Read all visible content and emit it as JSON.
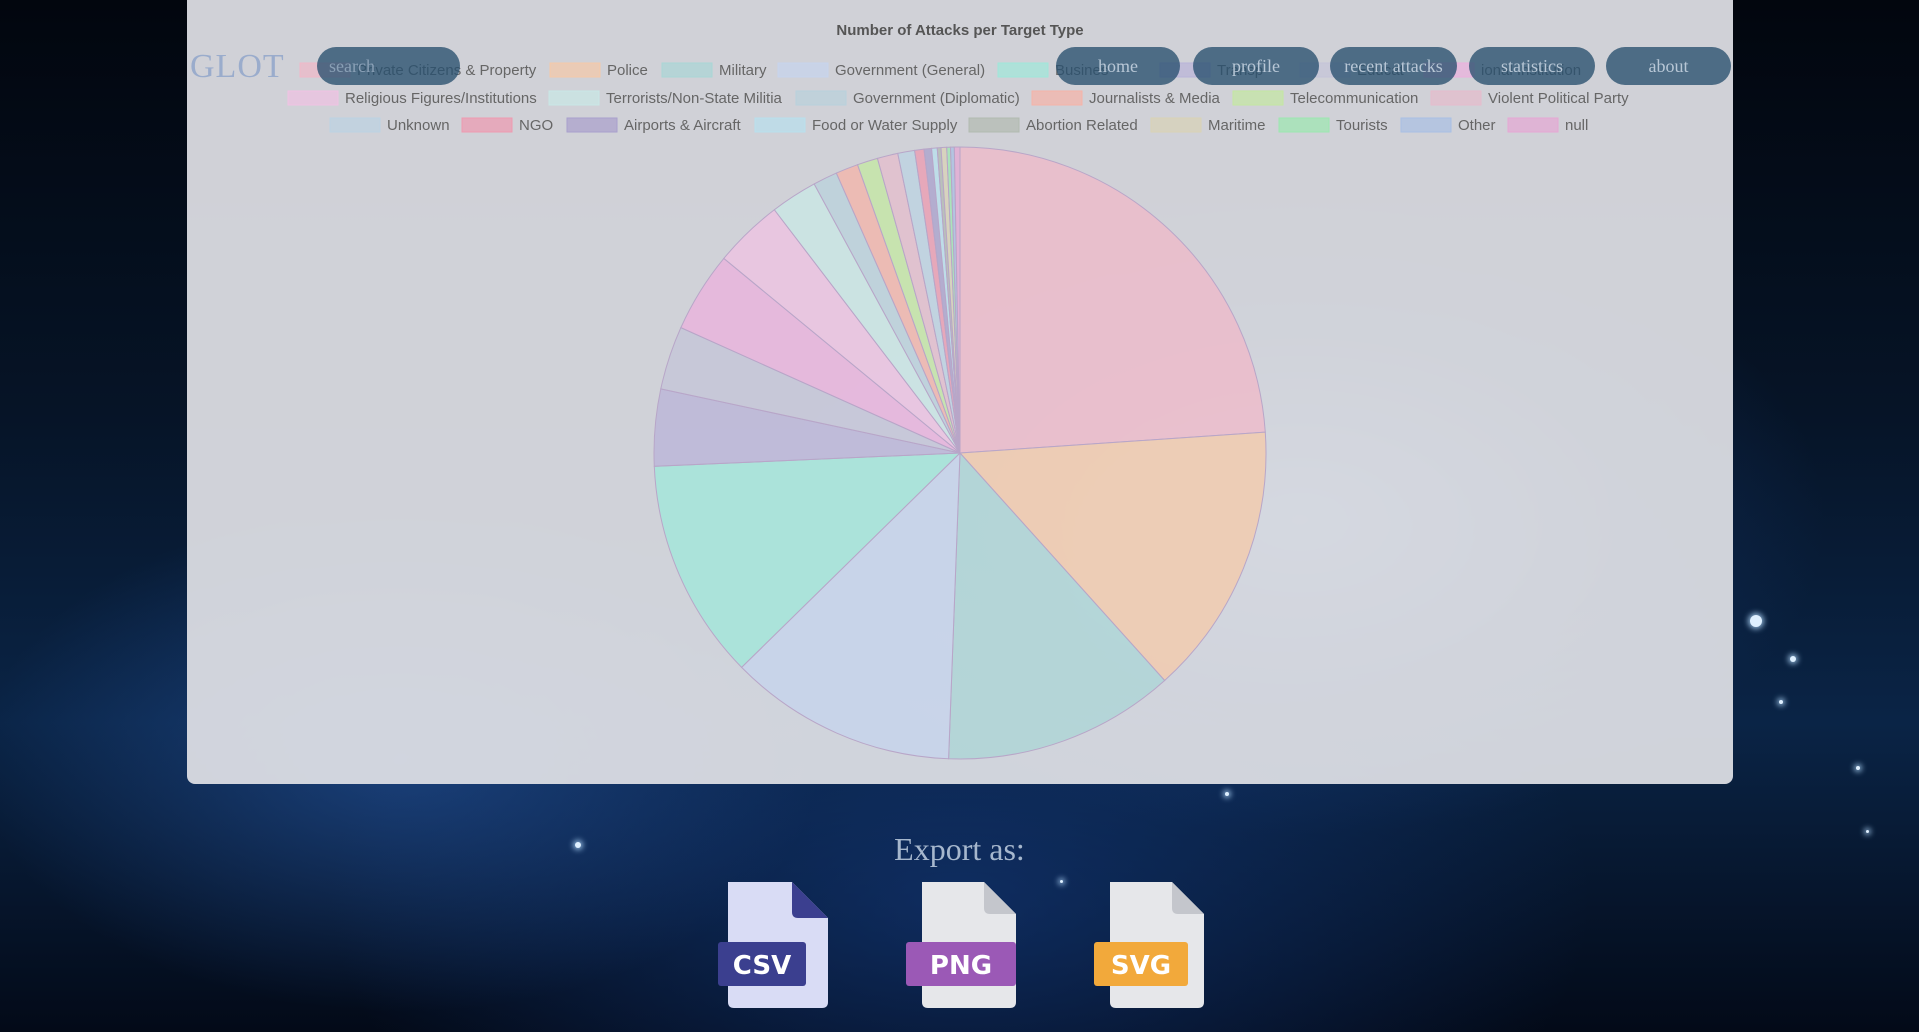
{
  "nav": {
    "logo": "GLOT",
    "search_placeholder": "search",
    "items": [
      "home",
      "profile",
      "recent attacks",
      "statistics",
      "about"
    ]
  },
  "export": {
    "title": "Export as:",
    "formats": [
      {
        "label": "CSV",
        "color": "#3b3f8f",
        "page": "#d9dcf5",
        "fold": "#3b3f8f"
      },
      {
        "label": "PNG",
        "color": "#9b59b6",
        "page": "#e6e7ea",
        "fold": "#c4c6cc"
      },
      {
        "label": "SVG",
        "color": "#f2a93b",
        "page": "#e6e7ea",
        "fold": "#c4c6cc"
      }
    ]
  },
  "chart_data": {
    "type": "pie",
    "title": "Number of Attacks per Target Type",
    "legend_position": "top",
    "categories": [
      "Private Citizens & Property",
      "Police",
      "Military",
      "Government (General)",
      "Business",
      "Transportation",
      "Utilities",
      "Educational Institution",
      "Religious Figures/Institutions",
      "Terrorists/Non-State Militia",
      "Government (Diplomatic)",
      "Journalists & Media",
      "Telecommunication",
      "Violent Political Party",
      "Unknown",
      "NGO",
      "Airports & Aircraft",
      "Food or Water Supply",
      "Abortion Related",
      "Maritime",
      "Tourists",
      "Other",
      "null"
    ],
    "legend_labels_visible": [
      "Private Citizens & Property",
      "Police",
      "Military",
      "Government (General)",
      "Busines",
      "Transp",
      "Educat",
      "ional Institution",
      "Religious Figures/Institutions",
      "Terrorists/Non-State Militia",
      "Government (Diplomatic)",
      "Journalists & Media",
      "Telecommunication",
      "Violent Political Party",
      "Unknown",
      "NGO",
      "Airports & Aircraft",
      "Food or Water Supply",
      "Abortion Related",
      "Maritime",
      "Tourists",
      "Other",
      "null"
    ],
    "values": [
      24.2,
      14.6,
      12.4,
      12.2,
      11.8,
      4.1,
      3.4,
      4.3,
      3.7,
      2.5,
      1.3,
      1.2,
      1.1,
      1.1,
      0.9,
      0.5,
      0.4,
      0.3,
      0.2,
      0.3,
      0.2,
      0.2,
      0.3
    ],
    "colors": [
      "#f0b8c8",
      "#f5c9a8",
      "#a9d6d6",
      "#c6d4ee",
      "#9fe8da",
      "#b9b3d8",
      "#c4c4d8",
      "#ecb0de",
      "#f0c2e3",
      "#c9e8e6",
      "#b9d1dc",
      "#f6b3a8",
      "#c4e8a2",
      "#e6bccc",
      "#bcd3e3",
      "#ee9ab0",
      "#a9a0cc",
      "#b8e0ee",
      "#b2bbb0",
      "#d9d3b6",
      "#9de8b0",
      "#a9c0e4",
      "#e6a8d4"
    ]
  }
}
